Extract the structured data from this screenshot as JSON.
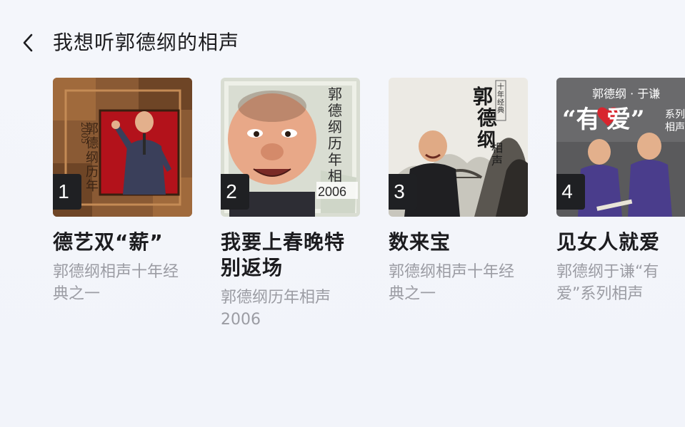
{
  "header": {
    "title": "我想听郭德纲的相声"
  },
  "cards": [
    {
      "rank": "1",
      "title": "德艺双“薪”",
      "subtitle": "郭德纲相声十年经典之一",
      "cover_text": "郭德纲历年相声",
      "cover_year": "2005"
    },
    {
      "rank": "2",
      "title": "我要上春晚特别返场",
      "subtitle": "郭德纲历年相声2006",
      "cover_text": "郭德纲历年相声",
      "cover_year": "2006"
    },
    {
      "rank": "3",
      "title": "数来宝",
      "subtitle": "郭德纲相声十年经典之一",
      "cover_text": "郭德纲相声",
      "cover_tag": "十年经典之"
    },
    {
      "rank": "4",
      "title": "见女人就爱",
      "subtitle": "郭德纲于谦“有爱”系列相声",
      "cover_header": "郭德纲 · 于谦",
      "cover_big": "“有爱”",
      "cover_series": "系列相声"
    }
  ]
}
